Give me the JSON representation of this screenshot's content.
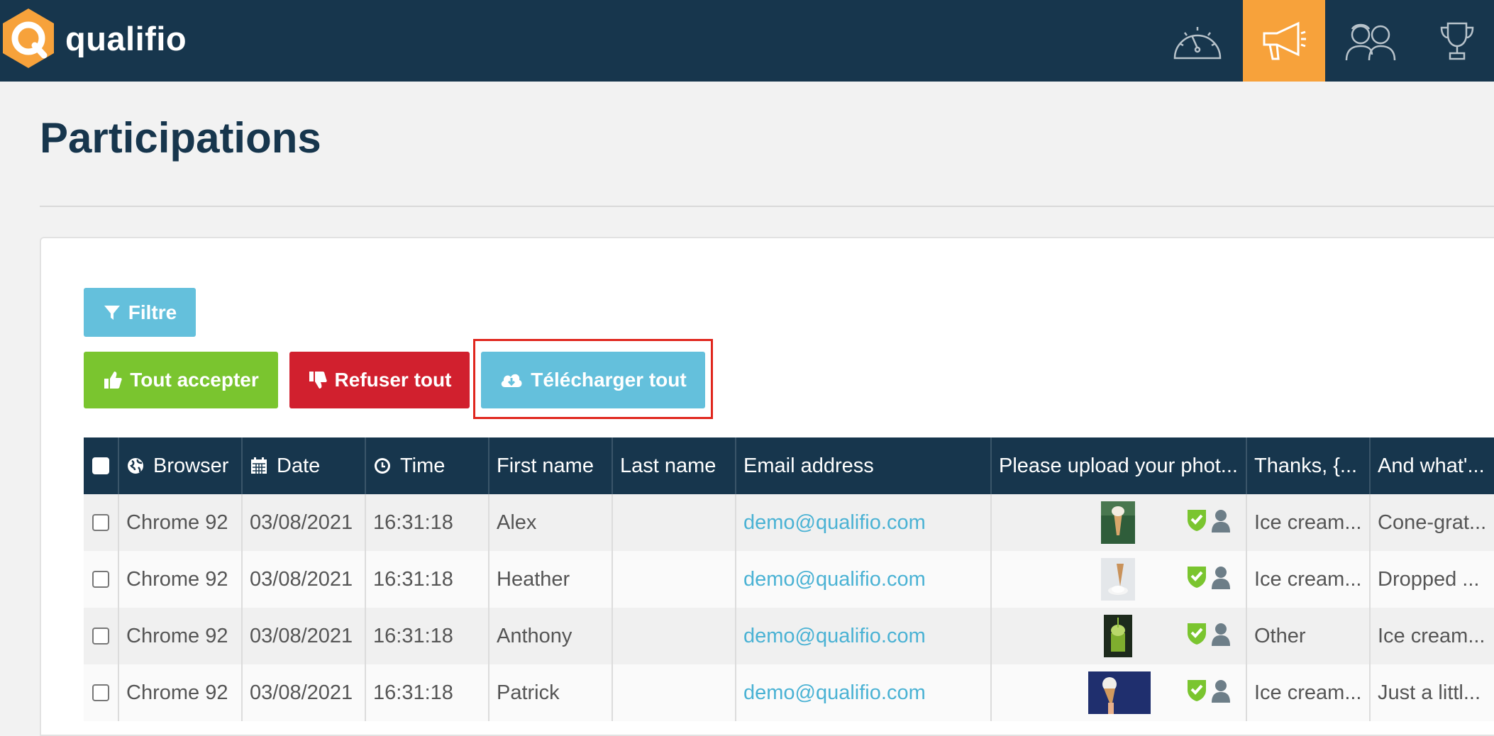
{
  "brand": {
    "name": "qualifio",
    "accent": "#f7a23b",
    "navbar_bg": "#17364d"
  },
  "nav": [
    {
      "icon": "dashboard-gauge-icon",
      "active": false
    },
    {
      "icon": "megaphone-icon",
      "active": true
    },
    {
      "icon": "participants-icon",
      "active": false
    },
    {
      "icon": "trophy-icon",
      "active": false
    }
  ],
  "page": {
    "title": "Participations"
  },
  "buttons": {
    "filter": "Filtre",
    "accept_all": "Tout accepter",
    "refuse_all": "Refuser tout",
    "download_all": "Télécharger tout"
  },
  "table": {
    "columns": [
      "Browser",
      "Date",
      "Time",
      "First name",
      "Last name",
      "Email address",
      "Please upload your phot...",
      "Thanks, {...",
      "And what'..."
    ],
    "rows": [
      {
        "browser": "Chrome 92",
        "date": "03/08/2021",
        "time": "16:31:18",
        "first_name": "Alex",
        "last_name": "",
        "email": "demo@qualifio.com",
        "answer1": "Ice cream...",
        "answer2": "Cone-grat..."
      },
      {
        "browser": "Chrome 92",
        "date": "03/08/2021",
        "time": "16:31:18",
        "first_name": "Heather",
        "last_name": "",
        "email": "demo@qualifio.com",
        "answer1": "Ice cream...",
        "answer2": "Dropped ..."
      },
      {
        "browser": "Chrome 92",
        "date": "03/08/2021",
        "time": "16:31:18",
        "first_name": "Anthony",
        "last_name": "",
        "email": "demo@qualifio.com",
        "answer1": "Other",
        "answer2": "Ice cream..."
      },
      {
        "browser": "Chrome 92",
        "date": "03/08/2021",
        "time": "16:31:18",
        "first_name": "Patrick",
        "last_name": "",
        "email": "demo@qualifio.com",
        "answer1": "Ice cream...",
        "answer2": "Just a littl..."
      }
    ]
  },
  "colors": {
    "accept": "#7ac52f",
    "refuse": "#d1202e",
    "info": "#64c0dc",
    "link": "#4ab2d4",
    "highlight": "#e0261d"
  }
}
